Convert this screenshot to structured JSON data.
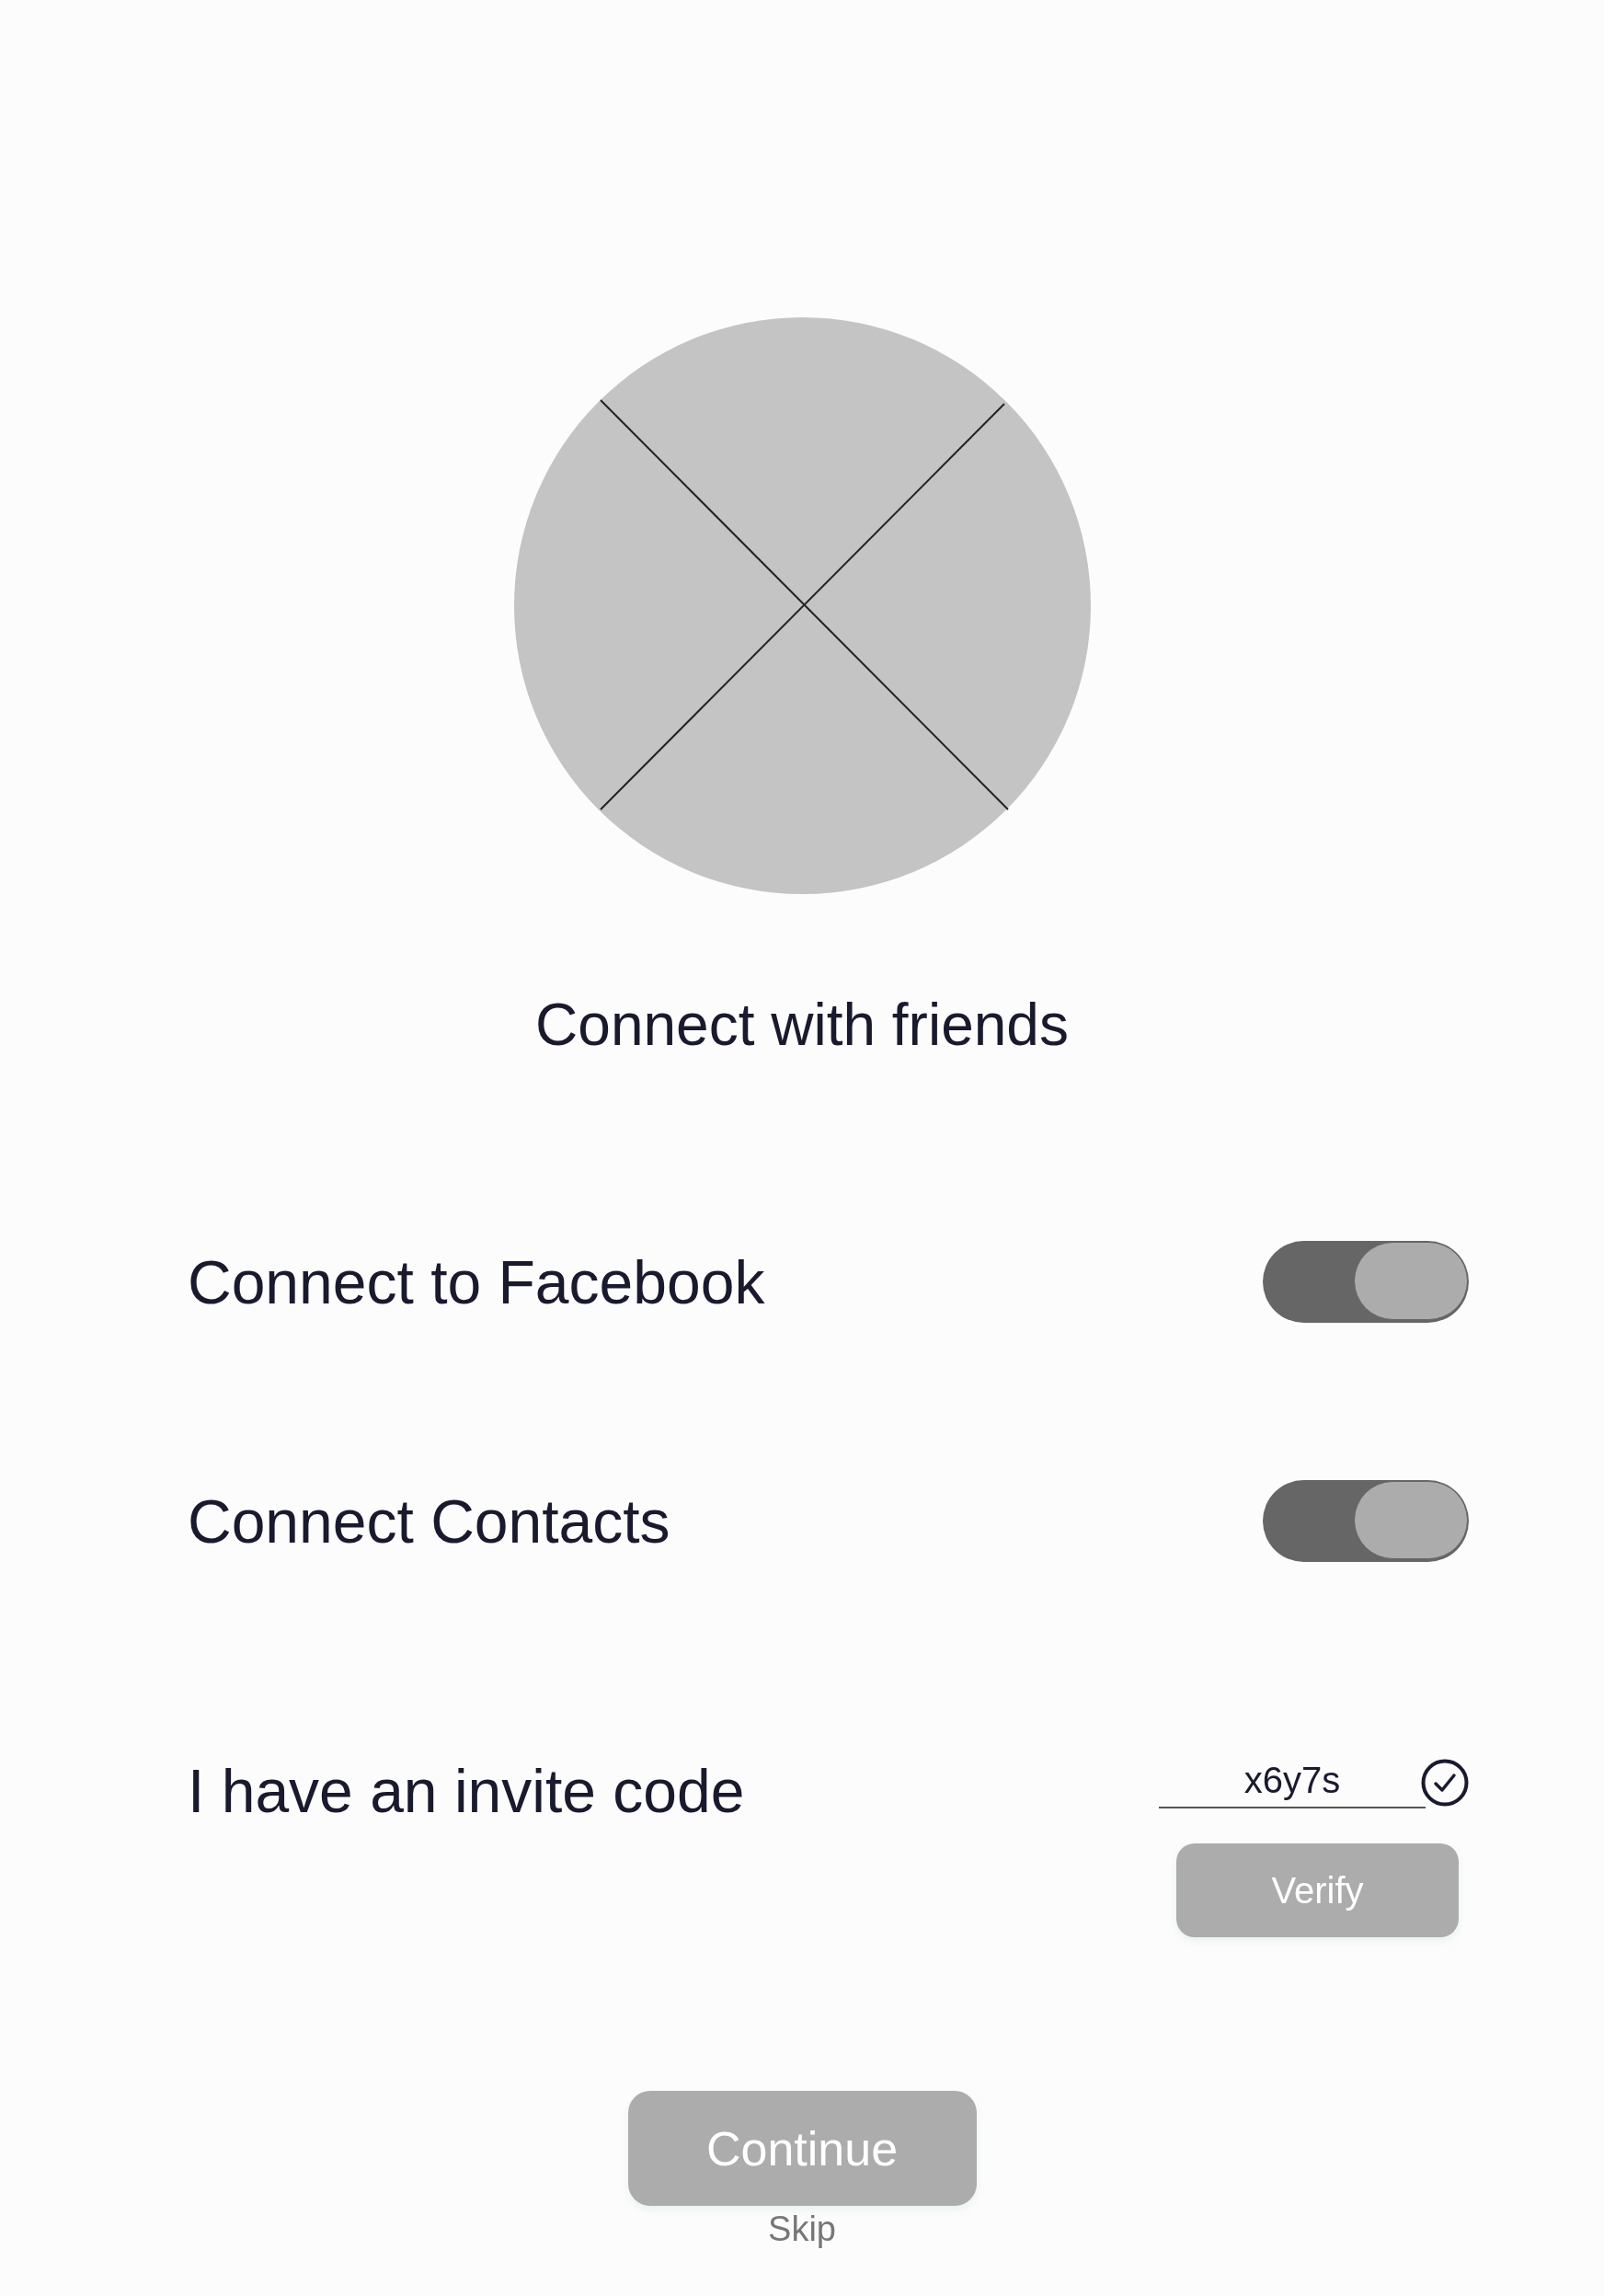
{
  "title": "Connect with friends",
  "toggles": [
    {
      "label": "Connect to Facebook",
      "on": true
    },
    {
      "label": "Connect Contacts",
      "on": true
    }
  ],
  "invite": {
    "label": "I have an invite code",
    "value": "x6y7s",
    "verified": true,
    "verify_button": "Verify"
  },
  "continue_button": "Continue",
  "skip_link": "Skip"
}
